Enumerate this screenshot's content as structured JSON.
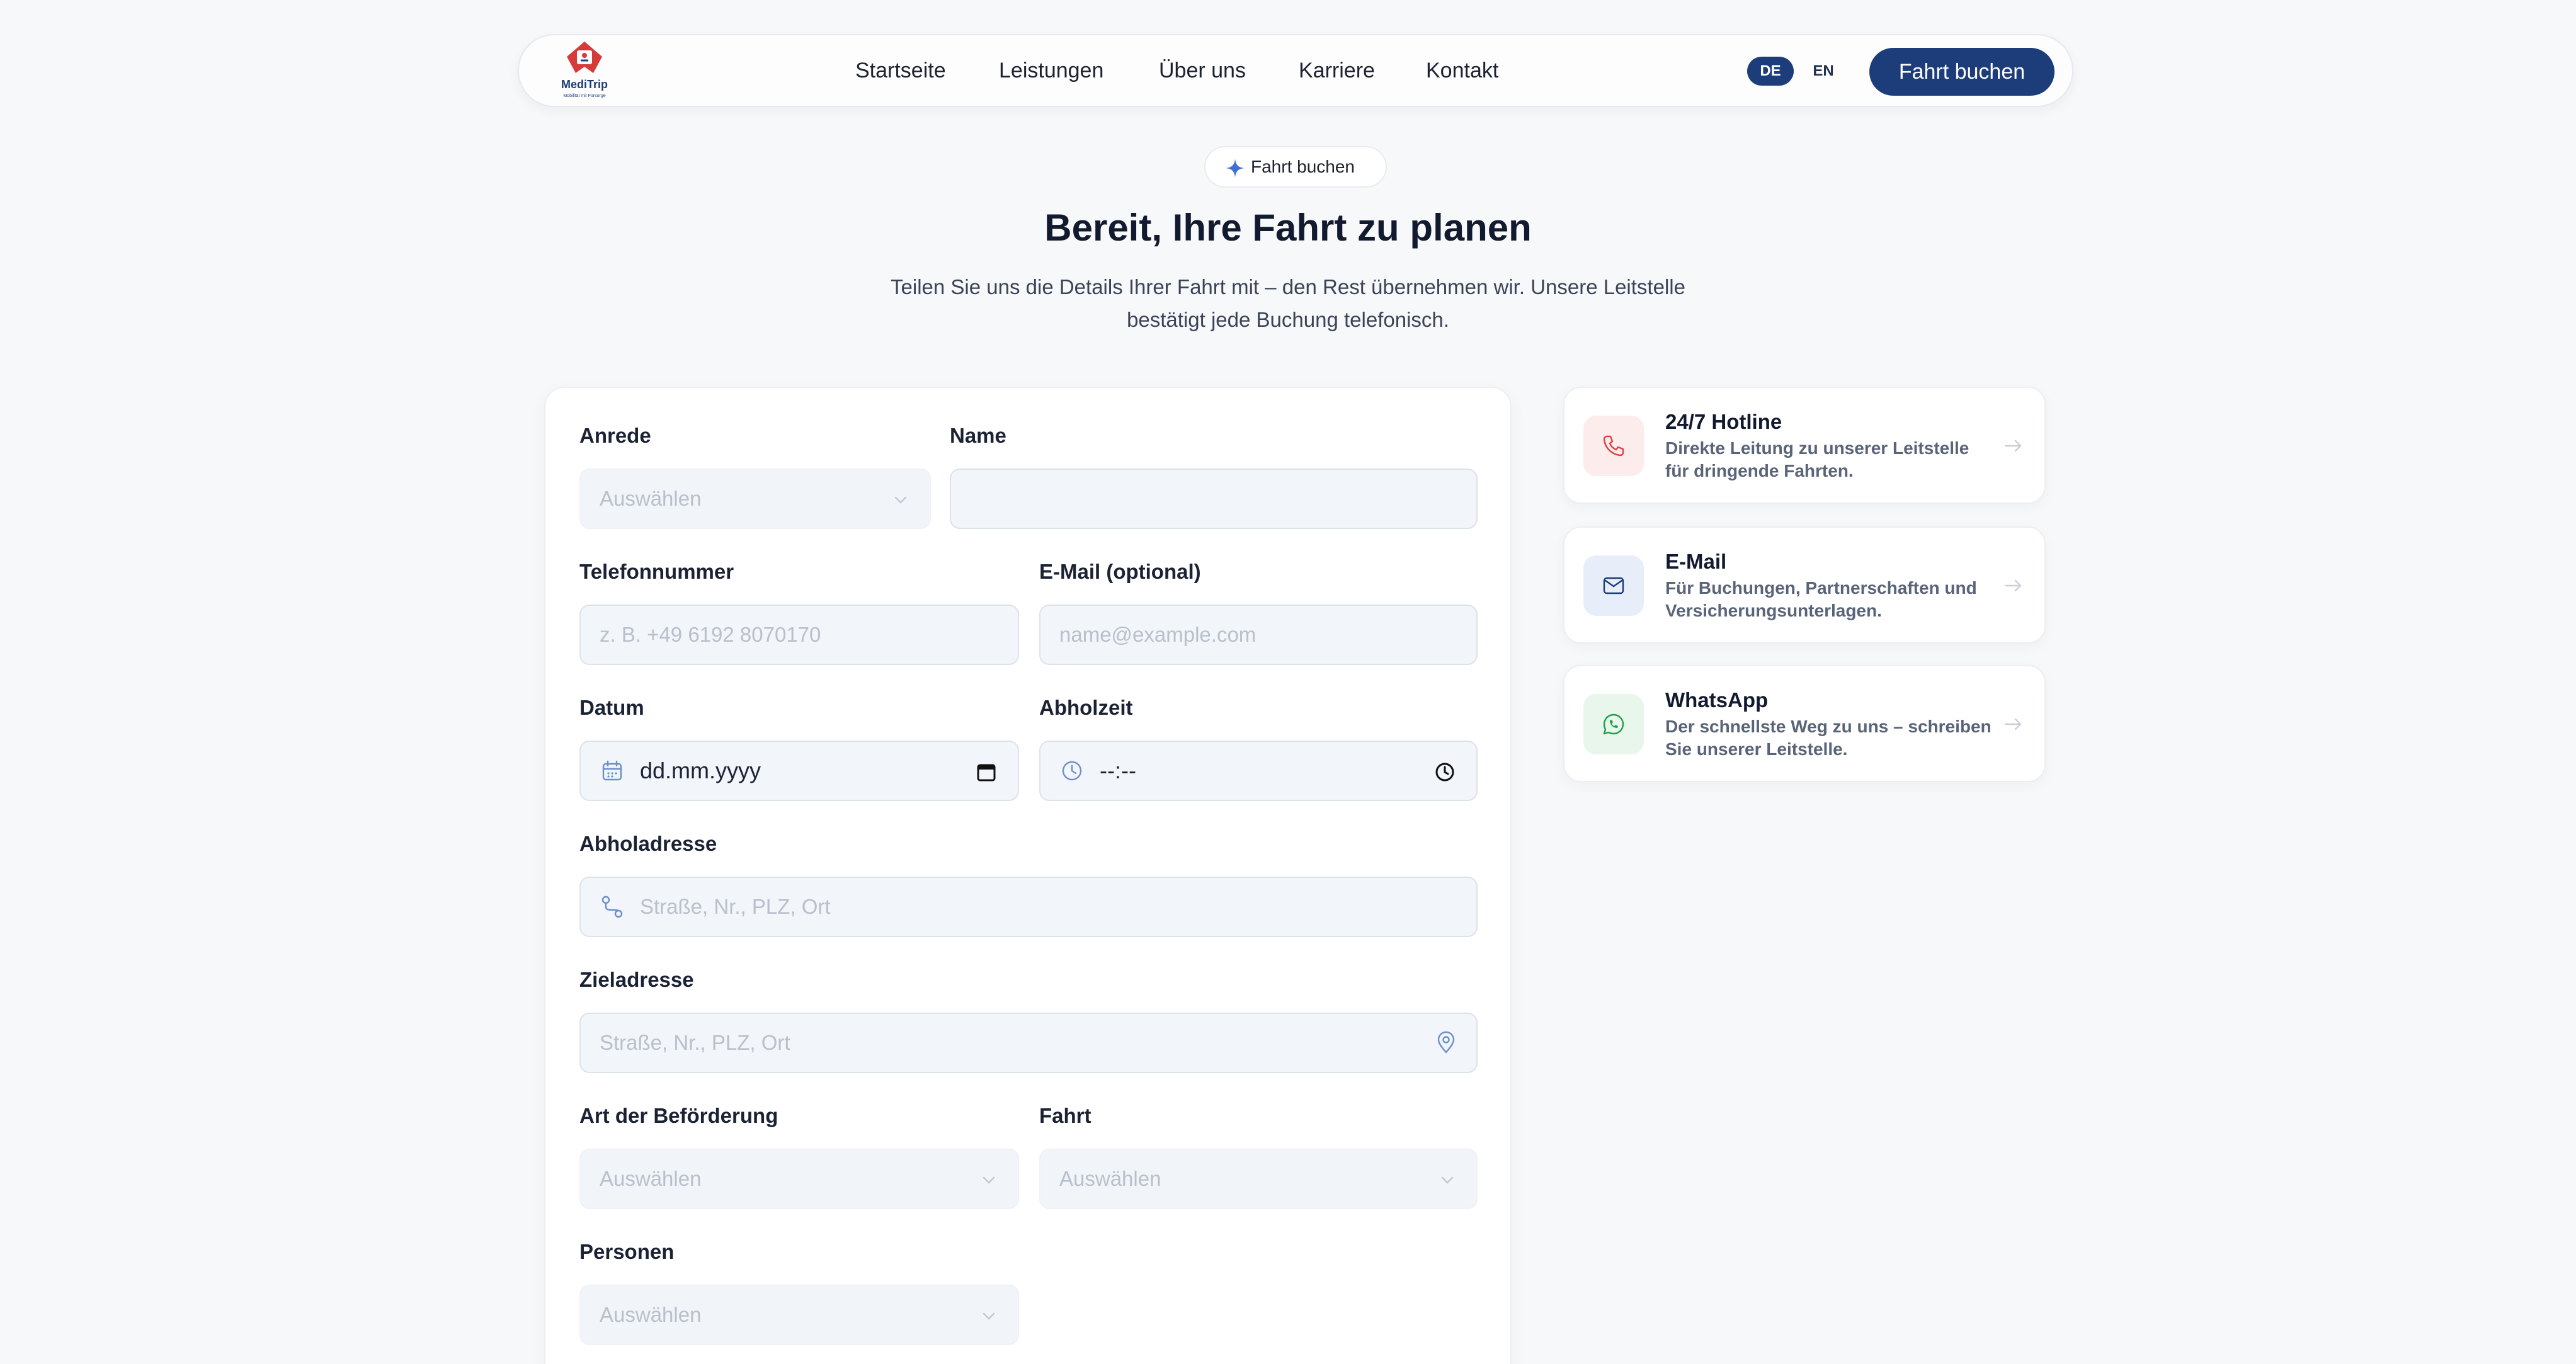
{
  "brand": {
    "name": "MediTrip",
    "tagline": "Mobilität mit Fürsorge"
  },
  "nav": {
    "links": [
      "Startseite",
      "Leistungen",
      "Über uns",
      "Karriere",
      "Kontakt"
    ],
    "lang_de": "DE",
    "lang_en": "EN",
    "cta": "Fahrt buchen"
  },
  "hero": {
    "badge": "Fahrt buchen",
    "title": "Bereit, Ihre Fahrt zu planen",
    "subtitle": "Teilen Sie uns die Details Ihrer Fahrt mit – den Rest übernehmen wir. Unsere Leitstelle bestätigt jede Buchung telefonisch."
  },
  "form": {
    "salutation": {
      "label": "Anrede",
      "placeholder": "Auswählen"
    },
    "name": {
      "label": "Name",
      "value": ""
    },
    "phone": {
      "label": "Telefonnummer",
      "placeholder": "z. B. +49 6192 8070170"
    },
    "email": {
      "label": "E-Mail (optional)",
      "placeholder": "name@example.com"
    },
    "date": {
      "label": "Datum",
      "value": "dd.mm.yyyy"
    },
    "time": {
      "label": "Abholzeit",
      "value": "--:--"
    },
    "pickup": {
      "label": "Abholadresse",
      "placeholder": "Straße, Nr., PLZ, Ort"
    },
    "destination": {
      "label": "Zieladresse",
      "placeholder": "Straße, Nr., PLZ, Ort"
    },
    "transport_type": {
      "label": "Art der Beförderung",
      "placeholder": "Auswählen"
    },
    "trip": {
      "label": "Fahrt",
      "placeholder": "Auswählen"
    },
    "persons": {
      "label": "Personen",
      "placeholder": "Auswählen"
    }
  },
  "contacts": [
    {
      "title": "24/7 Hotline",
      "desc": "Direkte Leitung zu unserer Leitstelle für dringende Fahrten.",
      "icon": "phone-icon",
      "color": "#d94545"
    },
    {
      "title": "E-Mail",
      "desc": "Für Buchungen, Partnerschaften und Versicherungsunterlagen.",
      "icon": "mail-icon",
      "color": "#1c3d7a"
    },
    {
      "title": "WhatsApp",
      "desc": "Der schnellste Weg zu uns – schreiben Sie unserer Leitstelle.",
      "icon": "whatsapp-icon",
      "color": "#21a047"
    }
  ],
  "colors": {
    "primary": "#1c3d7a",
    "accent_red": "#d94545",
    "accent_green": "#21a047"
  }
}
